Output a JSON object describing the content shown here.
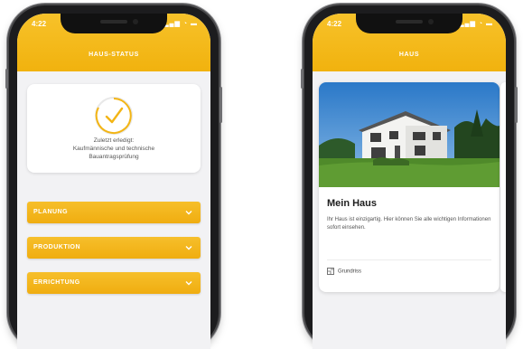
{
  "phone_left": {
    "status_bar": {
      "time": "4:22",
      "icons": "▂▄▆ ◔ ▬"
    },
    "header_title": "HAUS-STATUS",
    "status_card": {
      "line1": "Zuletzt erledigt:",
      "line2": "Kaufmännische und technische",
      "line3": "Bauantragsprüfung"
    },
    "accordions": [
      {
        "label": "PLANUNG"
      },
      {
        "label": "PRODUKTION"
      },
      {
        "label": "ERRICHTUNG"
      }
    ]
  },
  "phone_right": {
    "status_bar": {
      "time": "4:22",
      "icons": "▂▄▆ ◔ ▬"
    },
    "header_title": "HAUS",
    "card": {
      "title": "Mein Haus",
      "description": "Ihr Haus ist einzigartig. Hier können Sie alle wichtigen Informationen sofort einsehen.",
      "link": "Grundriss"
    }
  },
  "colors": {
    "accent": "#f3b515",
    "header": "#f4b916"
  },
  "icons": [
    "checkmark-icon",
    "chevron-down-icon",
    "floorplan-icon"
  ]
}
